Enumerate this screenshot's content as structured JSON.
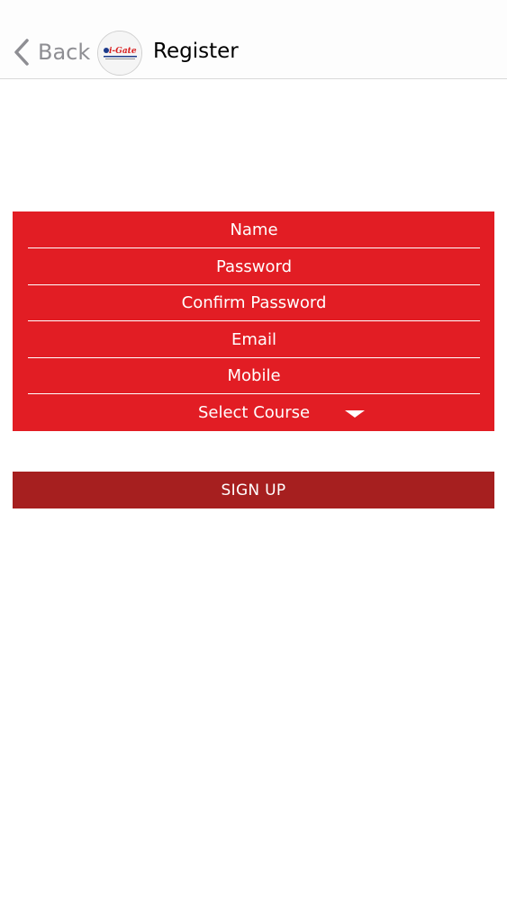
{
  "nav": {
    "back_label": "Back",
    "title": "Register",
    "logo_text": "i-Gate"
  },
  "form": {
    "fields": [
      {
        "placeholder": "Name"
      },
      {
        "placeholder": "Password"
      },
      {
        "placeholder": "Confirm Password"
      },
      {
        "placeholder": "Email"
      },
      {
        "placeholder": "Mobile"
      }
    ],
    "course_select": {
      "selected": "Select Course",
      "icon": "dropdown-caret-icon"
    }
  },
  "actions": {
    "signup_label": "SIGN UP"
  },
  "colors": {
    "form_background": "#e21d24",
    "signup_background": "#a61f1f",
    "back_tint": "#8e8e93"
  }
}
